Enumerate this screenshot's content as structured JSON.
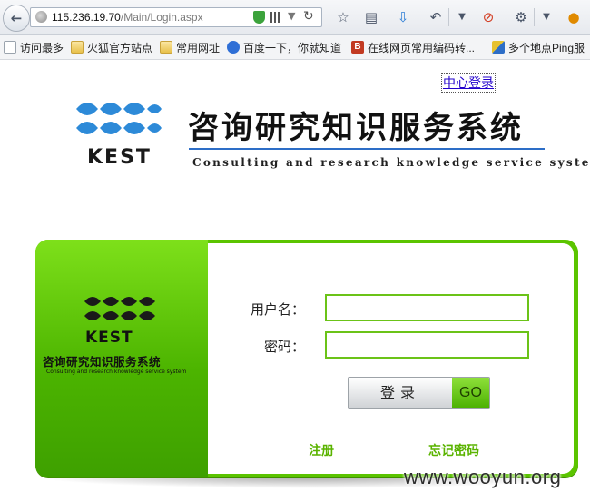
{
  "browser": {
    "url_host": "115.236.19.70",
    "url_path": "/Main/Login.aspx",
    "bookmarks": [
      {
        "label": "访问最多",
        "icon": "page-icon"
      },
      {
        "label": "火狐官方站点",
        "icon": "folder-icon"
      },
      {
        "label": "常用网址",
        "icon": "folder-icon"
      },
      {
        "label": "百度一下，你就知道",
        "icon": "baidu-paw-icon"
      },
      {
        "label": "在线网页常用编码转...",
        "icon": "b-site-icon"
      },
      {
        "label": "多个地点Ping服",
        "icon": "ping-site-icon"
      }
    ]
  },
  "header": {
    "center_login_link": "中心登录",
    "logo_text": "KEST",
    "title": "咨询研究知识服务系统",
    "subtitle": "Consulting and research knowledge service system"
  },
  "login_card": {
    "logo_text": "KEST",
    "title": "咨询研究知识服务系统",
    "subtitle": "Consulting and research knowledge service system",
    "username_label": "用户名：",
    "password_label": "密码：",
    "username_value": "",
    "password_value": "",
    "login_label": "登录",
    "go_label": "GO",
    "register_link": "注册",
    "forgot_link": "忘记密码"
  },
  "watermark": "www.wooyun.org",
  "colors": {
    "brand_green": "#5bc400",
    "logo_blue": "#2d8ad8",
    "link_green": "#5ab300",
    "link_blue": "#2200cc"
  }
}
